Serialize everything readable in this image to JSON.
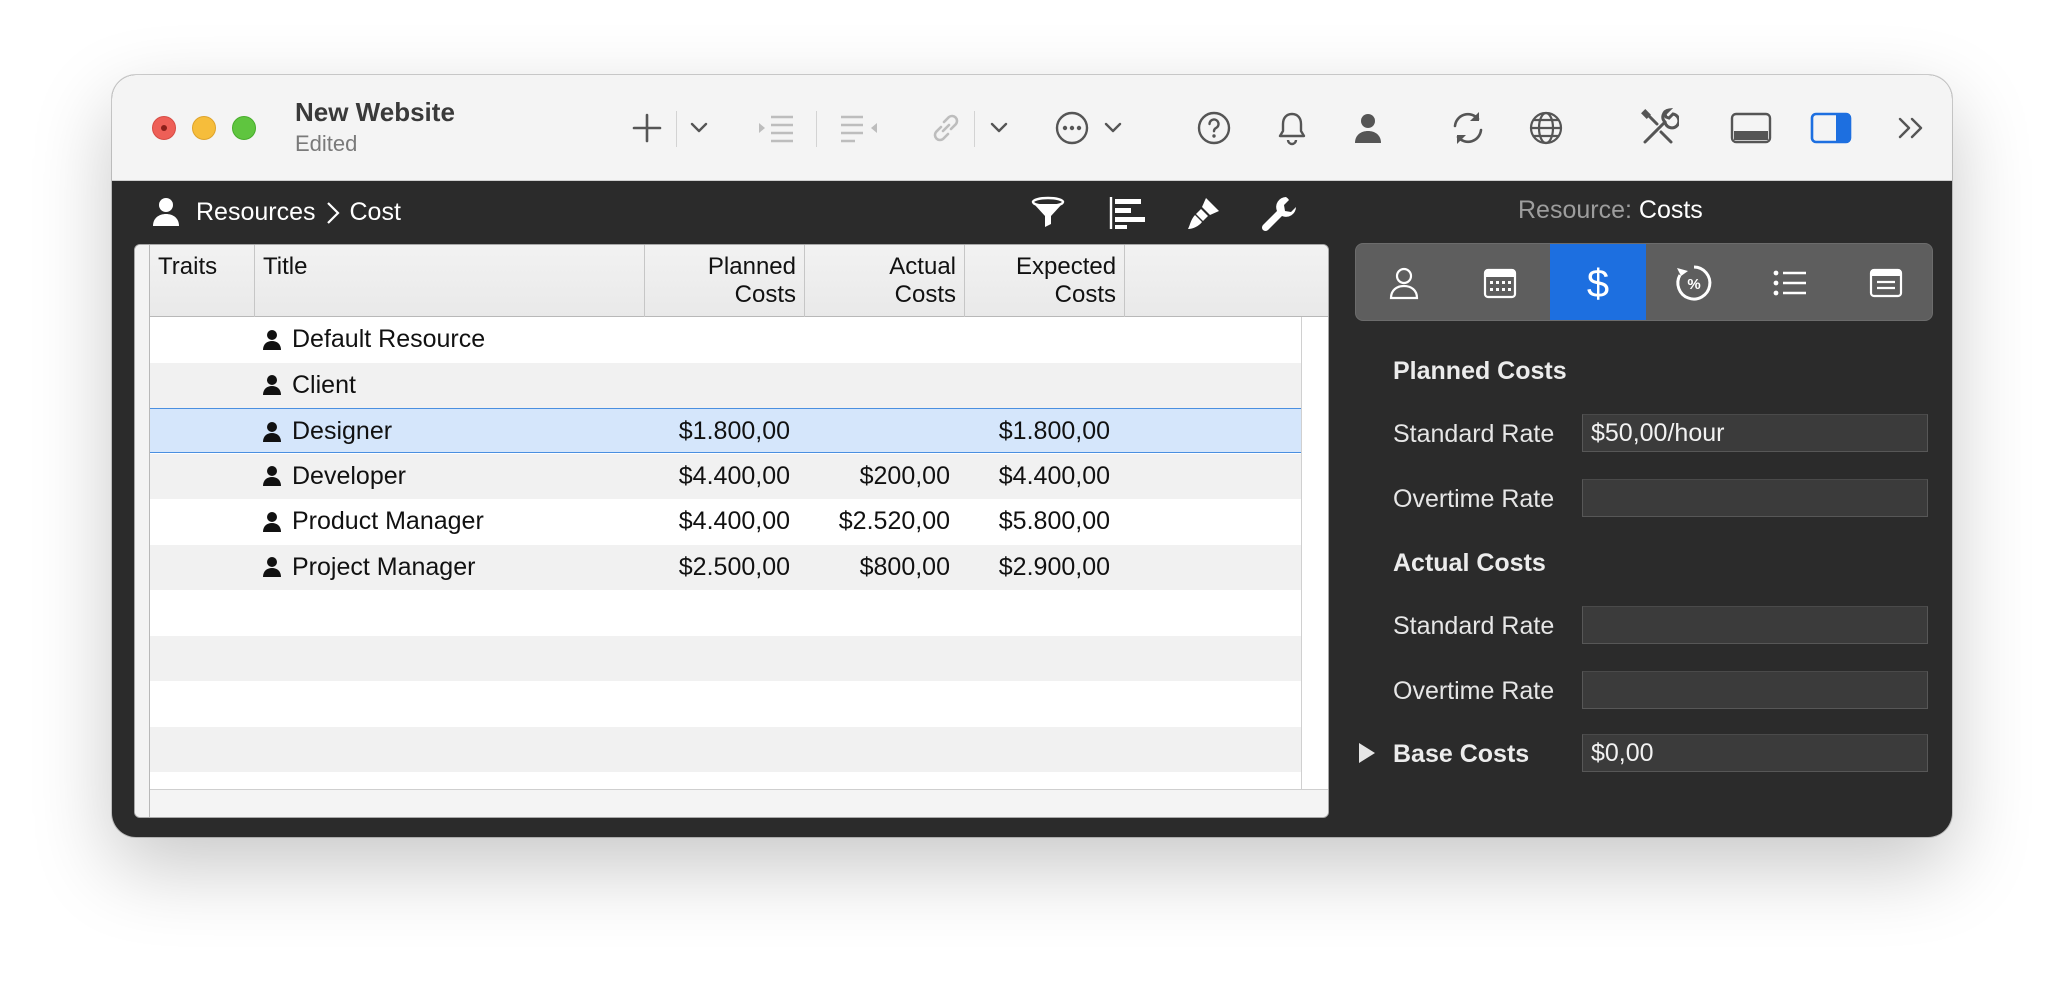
{
  "window": {
    "title": "New Website",
    "subtitle": "Edited"
  },
  "toolbar": {
    "icons": [
      "plus-icon",
      "chevron-down-icon",
      "indent-icon",
      "outdent-icon",
      "link-icon",
      "chevron-down-icon",
      "more-icon",
      "chevron-down-icon",
      "help-icon",
      "bell-icon",
      "person-icon",
      "sync-icon",
      "globe-icon",
      "tools-icon",
      "bottom-panel-icon",
      "right-sidebar-icon",
      "overflow-icon"
    ]
  },
  "pathbar": {
    "root": "Resources",
    "current": "Cost",
    "icons": [
      "filter-icon",
      "gantt-icon",
      "brush-icon",
      "wrench-icon"
    ]
  },
  "table": {
    "columns": [
      {
        "key": "traits",
        "label": "Traits"
      },
      {
        "key": "title",
        "label": "Title"
      },
      {
        "key": "planned",
        "label": "Planned Costs"
      },
      {
        "key": "actual",
        "label": "Actual Costs"
      },
      {
        "key": "expected",
        "label": "Expected Costs"
      }
    ],
    "rows": [
      {
        "title": "Default Resource",
        "planned": "",
        "actual": "",
        "expected": ""
      },
      {
        "title": "Client",
        "planned": "",
        "actual": "",
        "expected": ""
      },
      {
        "title": "Designer",
        "planned": "$1.800,00",
        "actual": "",
        "expected": "$1.800,00",
        "selected": true
      },
      {
        "title": "Developer",
        "planned": "$4.400,00",
        "actual": "$200,00",
        "expected": "$4.400,00"
      },
      {
        "title": "Product Manager",
        "planned": "$4.400,00",
        "actual": "$2.520,00",
        "expected": "$5.800,00"
      },
      {
        "title": "Project Manager",
        "planned": "$2.500,00",
        "actual": "$800,00",
        "expected": "$2.900,00"
      }
    ]
  },
  "inspector": {
    "title_prefix": "Resource:",
    "title": "Costs",
    "tabs": [
      "person-icon",
      "calendar-icon",
      "dollar-icon",
      "progress-percent-icon",
      "list-icon",
      "note-icon"
    ],
    "active_tab": 2,
    "planned_heading": "Planned Costs",
    "planned_standard_label": "Standard Rate",
    "planned_standard_value": "$50,00/hour",
    "planned_overtime_label": "Overtime Rate",
    "planned_overtime_value": "",
    "actual_heading": "Actual Costs",
    "actual_standard_label": "Standard Rate",
    "actual_standard_value": "",
    "actual_overtime_label": "Overtime Rate",
    "actual_overtime_value": "",
    "base_label": "Base Costs",
    "base_value": "$0,00"
  },
  "colors": {
    "accent": "#1d6fe0",
    "selection": "#d5e6fb",
    "dark_bg": "#2b2b2b"
  }
}
